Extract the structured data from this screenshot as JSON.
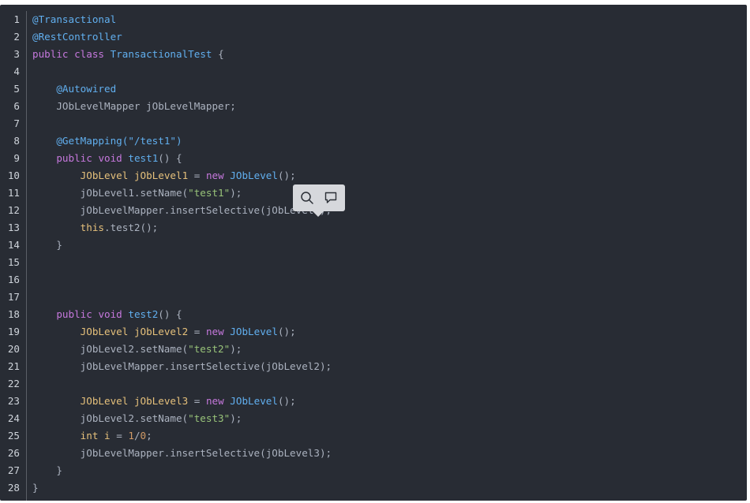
{
  "code": {
    "lines": [
      {
        "n": "1",
        "t": [
          {
            "c": "ann",
            "s": "@Transactional"
          }
        ]
      },
      {
        "n": "2",
        "t": [
          {
            "c": "ann",
            "s": "@RestController"
          }
        ]
      },
      {
        "n": "3",
        "t": [
          {
            "c": "kw",
            "s": "public"
          },
          {
            "c": "def",
            "s": " "
          },
          {
            "c": "kw",
            "s": "class"
          },
          {
            "c": "def",
            "s": " "
          },
          {
            "c": "cls",
            "s": "TransactionalTest"
          },
          {
            "c": "def",
            "s": " {"
          }
        ]
      },
      {
        "n": "4",
        "t": []
      },
      {
        "n": "5",
        "t": [
          {
            "c": "def",
            "s": "    "
          },
          {
            "c": "ann",
            "s": "@Autowired"
          }
        ]
      },
      {
        "n": "6",
        "t": [
          {
            "c": "def",
            "s": "    JObLevelMapper jObLevelMapper;"
          }
        ]
      },
      {
        "n": "7",
        "t": []
      },
      {
        "n": "8",
        "t": [
          {
            "c": "def",
            "s": "    "
          },
          {
            "c": "ann",
            "s": "@GetMapping(\"/test1\")"
          }
        ]
      },
      {
        "n": "9",
        "t": [
          {
            "c": "def",
            "s": "    "
          },
          {
            "c": "kw",
            "s": "public"
          },
          {
            "c": "def",
            "s": " "
          },
          {
            "c": "kw",
            "s": "void"
          },
          {
            "c": "def",
            "s": " "
          },
          {
            "c": "fn",
            "s": "test1"
          },
          {
            "c": "def",
            "s": "() {"
          }
        ]
      },
      {
        "n": "10",
        "t": [
          {
            "c": "def",
            "s": "        "
          },
          {
            "c": "typ",
            "s": "JObLevel"
          },
          {
            "c": "def",
            "s": " "
          },
          {
            "c": "var",
            "s": "jObLevel1"
          },
          {
            "c": "def",
            "s": " = "
          },
          {
            "c": "kw",
            "s": "new"
          },
          {
            "c": "def",
            "s": " "
          },
          {
            "c": "fn",
            "s": "JObLevel"
          },
          {
            "c": "def",
            "s": "();"
          }
        ]
      },
      {
        "n": "11",
        "t": [
          {
            "c": "def",
            "s": "        jObLevel1.setName("
          },
          {
            "c": "str",
            "s": "\"test1\""
          },
          {
            "c": "def",
            "s": ");"
          }
        ]
      },
      {
        "n": "12",
        "t": [
          {
            "c": "def",
            "s": "        jObLevelMapper.insertSelective(jObLevel1);"
          }
        ]
      },
      {
        "n": "13",
        "t": [
          {
            "c": "def",
            "s": "        "
          },
          {
            "c": "this",
            "s": "this"
          },
          {
            "c": "def",
            "s": ".test2();"
          }
        ]
      },
      {
        "n": "14",
        "t": [
          {
            "c": "def",
            "s": "    }"
          }
        ]
      },
      {
        "n": "15",
        "t": []
      },
      {
        "n": "16",
        "t": []
      },
      {
        "n": "17",
        "t": []
      },
      {
        "n": "18",
        "t": [
          {
            "c": "def",
            "s": "    "
          },
          {
            "c": "kw",
            "s": "public"
          },
          {
            "c": "def",
            "s": " "
          },
          {
            "c": "kw",
            "s": "void"
          },
          {
            "c": "def",
            "s": " "
          },
          {
            "c": "fn",
            "s": "test2"
          },
          {
            "c": "def",
            "s": "() {"
          }
        ]
      },
      {
        "n": "19",
        "t": [
          {
            "c": "def",
            "s": "        "
          },
          {
            "c": "typ",
            "s": "JObLevel"
          },
          {
            "c": "def",
            "s": " "
          },
          {
            "c": "var",
            "s": "jObLevel2"
          },
          {
            "c": "def",
            "s": " = "
          },
          {
            "c": "kw",
            "s": "new"
          },
          {
            "c": "def",
            "s": " "
          },
          {
            "c": "fn",
            "s": "JObLevel"
          },
          {
            "c": "def",
            "s": "();"
          }
        ]
      },
      {
        "n": "20",
        "t": [
          {
            "c": "def",
            "s": "        jObLevel2.setName("
          },
          {
            "c": "str",
            "s": "\"test2\""
          },
          {
            "c": "def",
            "s": ");"
          }
        ]
      },
      {
        "n": "21",
        "t": [
          {
            "c": "def",
            "s": "        jObLevelMapper.insertSelective(jObLevel2);"
          }
        ]
      },
      {
        "n": "22",
        "t": []
      },
      {
        "n": "23",
        "t": [
          {
            "c": "def",
            "s": "        "
          },
          {
            "c": "typ",
            "s": "JObLevel"
          },
          {
            "c": "def",
            "s": " "
          },
          {
            "c": "var",
            "s": "jObLevel3"
          },
          {
            "c": "def",
            "s": " = "
          },
          {
            "c": "kw",
            "s": "new"
          },
          {
            "c": "def",
            "s": " "
          },
          {
            "c": "fn",
            "s": "JObLevel"
          },
          {
            "c": "def",
            "s": "();"
          }
        ]
      },
      {
        "n": "24",
        "t": [
          {
            "c": "def",
            "s": "        jObLevel2.setName("
          },
          {
            "c": "str",
            "s": "\"test3\""
          },
          {
            "c": "def",
            "s": ");"
          }
        ]
      },
      {
        "n": "25",
        "t": [
          {
            "c": "def",
            "s": "        "
          },
          {
            "c": "typ",
            "s": "int"
          },
          {
            "c": "def",
            "s": " "
          },
          {
            "c": "var",
            "s": "i"
          },
          {
            "c": "def",
            "s": " = "
          },
          {
            "c": "num",
            "s": "1"
          },
          {
            "c": "def",
            "s": "/"
          },
          {
            "c": "num",
            "s": "0"
          },
          {
            "c": "def",
            "s": ";"
          }
        ]
      },
      {
        "n": "26",
        "t": [
          {
            "c": "def",
            "s": "        jObLevelMapper.insertSelective(jObLevel3);"
          }
        ]
      },
      {
        "n": "27",
        "t": [
          {
            "c": "def",
            "s": "    }"
          }
        ]
      },
      {
        "n": "28",
        "t": [
          {
            "c": "def",
            "s": "}"
          }
        ]
      }
    ]
  },
  "popover": {
    "buttons": [
      {
        "name": "search-button",
        "icon": "search-icon"
      },
      {
        "name": "comment-button",
        "icon": "comment-icon"
      }
    ]
  },
  "colors": {
    "background": "#282c34",
    "annotation": "#61afef",
    "keyword": "#c678dd",
    "type": "#e5c07b",
    "string": "#98c379",
    "number": "#d19a66",
    "default": "#abb2bf"
  }
}
